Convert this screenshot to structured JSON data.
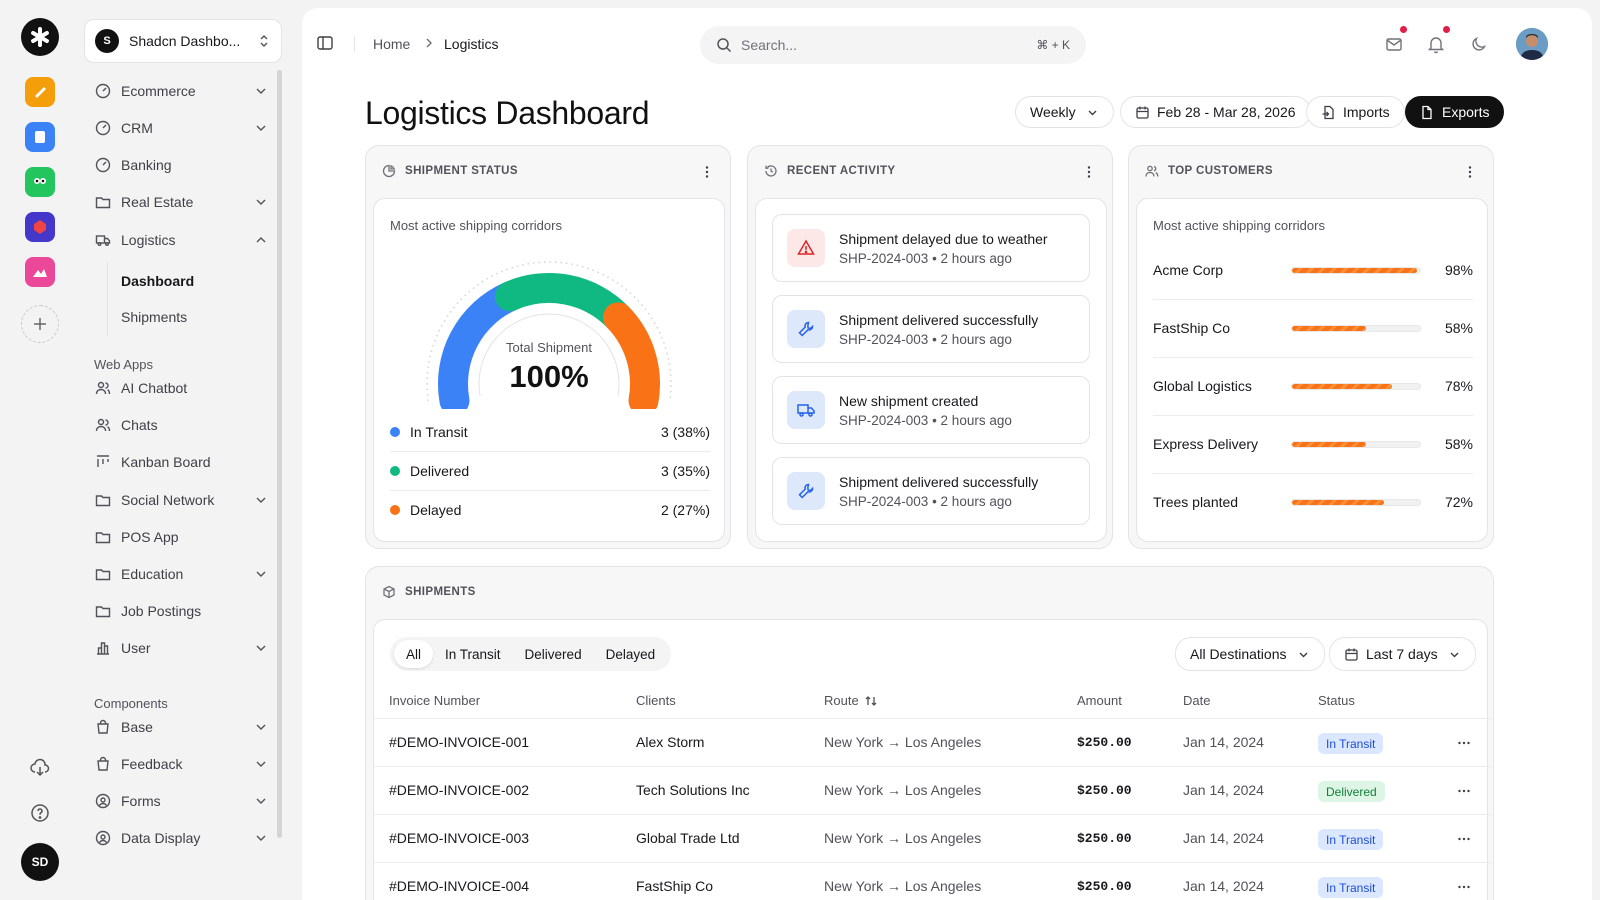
{
  "sidebar": {
    "workspace": {
      "initial": "S",
      "name": "Shadcn Dashbo..."
    },
    "items": [
      {
        "label": "Ecommerce"
      },
      {
        "label": "CRM"
      },
      {
        "label": "Banking"
      },
      {
        "label": "Real Estate"
      },
      {
        "label": "Logistics"
      }
    ],
    "logistics_sub": [
      {
        "label": "Dashboard"
      },
      {
        "label": "Shipments"
      }
    ],
    "web_apps_title": "Web Apps",
    "web_apps": [
      {
        "label": "AI Chatbot"
      },
      {
        "label": "Chats"
      },
      {
        "label": "Kanban Board"
      },
      {
        "label": "Social Network"
      },
      {
        "label": "POS App"
      },
      {
        "label": "Education"
      },
      {
        "label": "Job Postings"
      },
      {
        "label": "User"
      }
    ],
    "components_title": "Components",
    "components": [
      {
        "label": "Base"
      },
      {
        "label": "Feedback"
      },
      {
        "label": "Forms"
      },
      {
        "label": "Data Display"
      }
    ]
  },
  "rail": {
    "user_initials": "SD"
  },
  "topbar": {
    "breadcrumb": [
      "Home",
      "Logistics"
    ],
    "search_placeholder": "Search...",
    "search_shortcut": "⌘ + K"
  },
  "page": {
    "title": "Logistics Dashboard",
    "period": "Weekly",
    "date_range": "Feb 28 - Mar 28, 2026",
    "imports": "Imports",
    "exports": "Exports"
  },
  "shipment_status": {
    "title": "SHIPMENT STATUS",
    "subtitle": "Most active shipping corridors",
    "total_label": "Total Shipment",
    "total_value": "100%",
    "segments": [
      {
        "label": "In Transit",
        "value": "3 (38%)",
        "percent": 38,
        "color": "#3b82f6"
      },
      {
        "label": "Delivered",
        "value": "3 (35%)",
        "percent": 35,
        "color": "#10b981"
      },
      {
        "label": "Delayed",
        "value": "2 (27%)",
        "percent": 27,
        "color": "#f97316"
      }
    ]
  },
  "recent_activity": {
    "title": "RECENT ACTIVITY",
    "items": [
      {
        "title": "Shipment delayed due to weather",
        "id": "SHP-2024-003",
        "time": "2 hours ago",
        "icon": "warning-icon",
        "tint": "#fde8e8",
        "color": "#dc2626"
      },
      {
        "title": "Shipment delivered successfully",
        "id": "SHP-2024-003",
        "time": "2 hours ago",
        "icon": "wrench-icon",
        "tint": "#dde8fb",
        "color": "#2563eb"
      },
      {
        "title": "New shipment created",
        "id": "SHP-2024-003",
        "time": "2 hours ago",
        "icon": "truck-icon",
        "tint": "#dde8fb",
        "color": "#2563eb"
      },
      {
        "title": "Shipment delivered successfully",
        "id": "SHP-2024-003",
        "time": "2 hours ago",
        "icon": "wrench-icon",
        "tint": "#dde8fb",
        "color": "#2563eb"
      }
    ]
  },
  "top_customers": {
    "title": "TOP CUSTOMERS",
    "subtitle": "Most active shipping corridors",
    "items": [
      {
        "name": "Acme Corp",
        "percent": 98,
        "label": "98%"
      },
      {
        "name": "FastShip Co",
        "percent": 58,
        "label": "58%"
      },
      {
        "name": "Global Logistics",
        "percent": 78,
        "label": "78%"
      },
      {
        "name": "Express Delivery",
        "percent": 58,
        "label": "58%"
      },
      {
        "name": "Trees planted",
        "percent": 72,
        "label": "72%"
      }
    ]
  },
  "shipments": {
    "title": "SHIPMENTS",
    "tabs": [
      "All",
      "In Transit",
      "Delivered",
      "Delayed"
    ],
    "destination_filter": "All Destinations",
    "range_filter": "Last 7 days",
    "columns": [
      "Invoice Number",
      "Clients",
      "Route",
      "Amount",
      "Date",
      "Status"
    ],
    "rows": [
      {
        "invoice": "#DEMO-INVOICE-001",
        "client": "Alex Storm",
        "route": "New York → Los Angeles",
        "amount": "$250.00",
        "date": "Jan 14, 2024",
        "status": "In Transit"
      },
      {
        "invoice": "#DEMO-INVOICE-002",
        "client": "Tech Solutions Inc",
        "route": "New York → Los Angeles",
        "amount": "$250.00",
        "date": "Jan 14, 2024",
        "status": "Delivered"
      },
      {
        "invoice": "#DEMO-INVOICE-003",
        "client": "Global Trade Ltd",
        "route": "New York → Los Angeles",
        "amount": "$250.00",
        "date": "Jan 14, 2024",
        "status": "In Transit"
      },
      {
        "invoice": "#DEMO-INVOICE-004",
        "client": "FastShip Co",
        "route": "New York → Los Angeles",
        "amount": "$250.00",
        "date": "Jan 14, 2024",
        "status": "In Transit"
      }
    ]
  },
  "colors": {
    "accent": "#111111",
    "orange": "#f97316",
    "blue": "#3b82f6",
    "green": "#10b981"
  }
}
